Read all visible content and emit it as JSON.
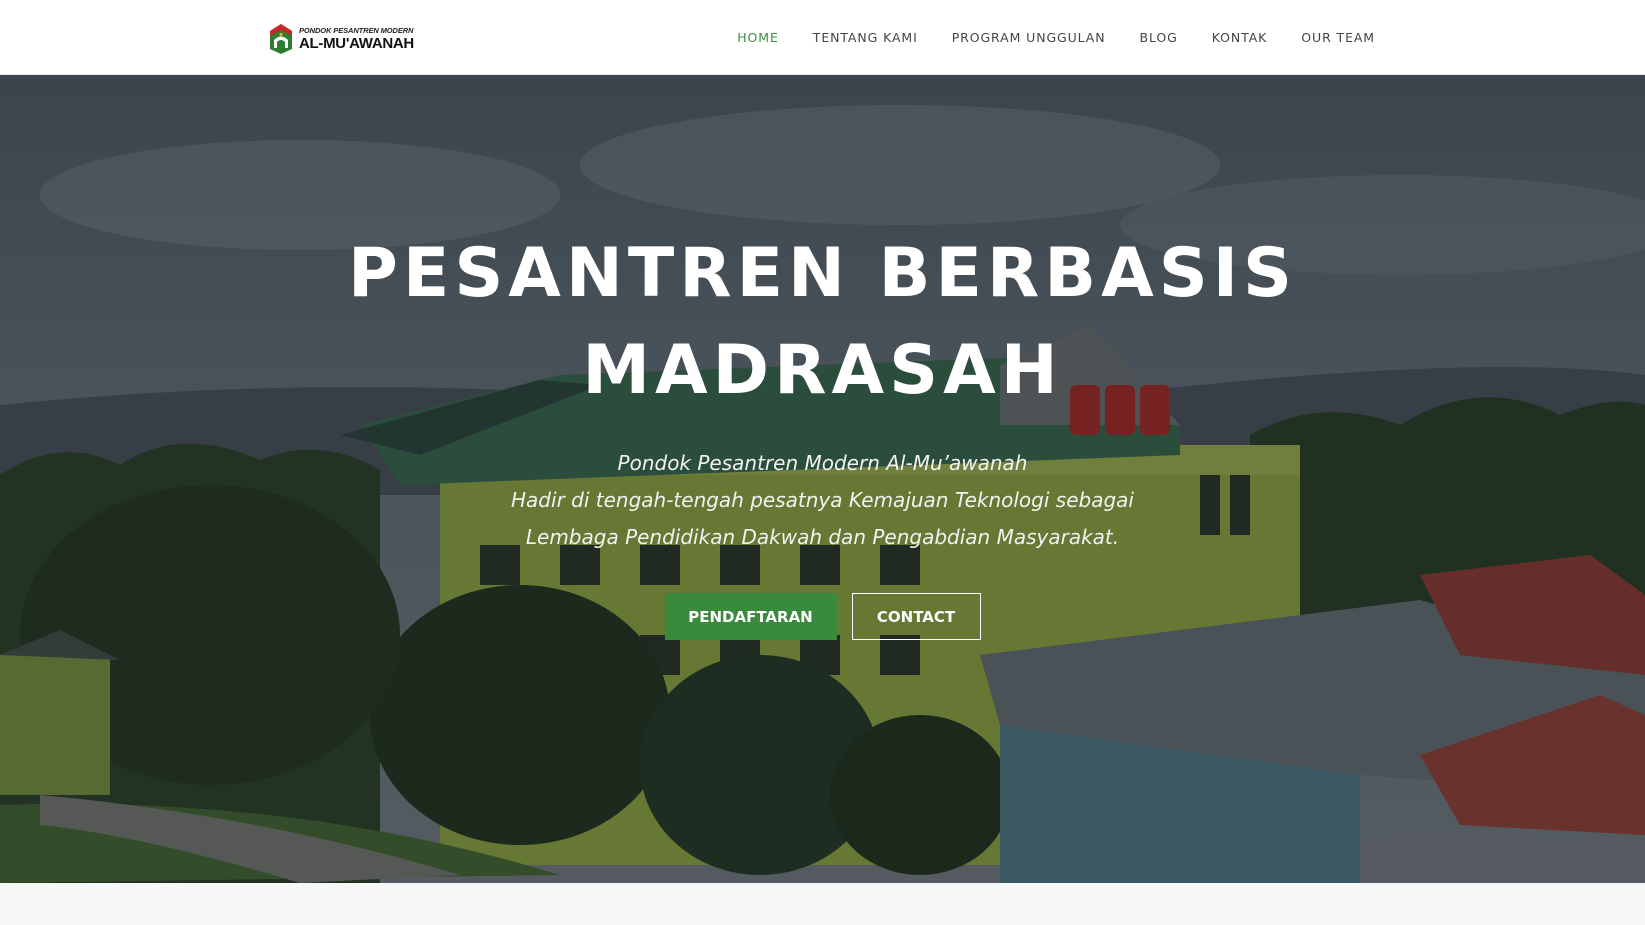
{
  "brand": {
    "line1": "PONDOK PESANTREN MODERN",
    "line2": "AL-MU'AWANAH",
    "emblem_icon": "mosque-emblem-icon"
  },
  "nav": {
    "items": [
      {
        "label": "HOME",
        "active": true
      },
      {
        "label": "TENTANG KAMI",
        "active": false
      },
      {
        "label": "PROGRAM UNGGULAN",
        "active": false
      },
      {
        "label": "BLOG",
        "active": false
      },
      {
        "label": "KONTAK",
        "active": false
      },
      {
        "label": "OUR TEAM",
        "active": false
      }
    ]
  },
  "hero": {
    "title_line1": "PESANTREN BERBASIS",
    "title_line2": "MADRASAH",
    "subtitle_lines": [
      "Pondok Pesantren Modern Al-Mu’awanah",
      "Hadir di tengah-tengah pesatnya Kemajuan Teknologi sebagai",
      "Lembaga Pendidikan Dakwah dan Pengabdian Masyarakat."
    ],
    "primary_button": "PENDAFTARAN",
    "secondary_button": "CONTACT"
  },
  "colors": {
    "accent": "#3a8a3d",
    "nav_active": "#3e8e41",
    "nav_text": "#444444",
    "hero_text": "#ffffff"
  }
}
